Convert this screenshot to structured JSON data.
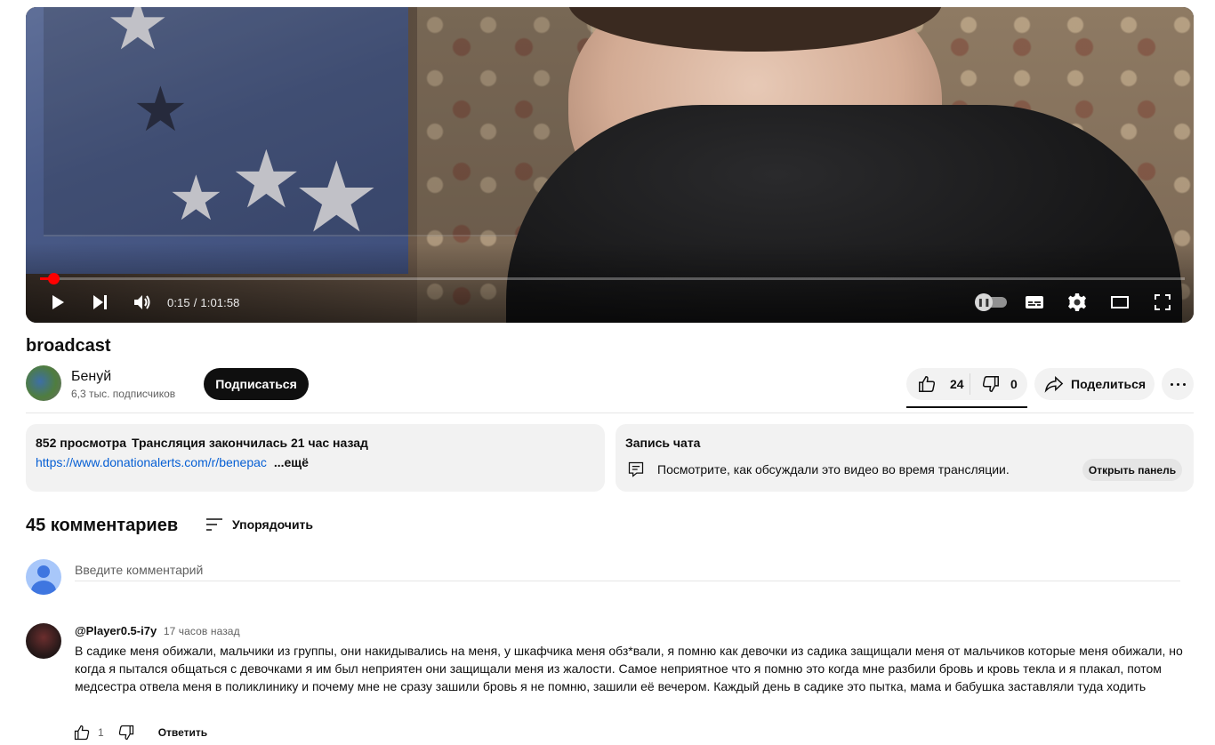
{
  "player": {
    "current_time": "0:15",
    "separator": "/",
    "duration": "1:01:58",
    "progress_fraction": 0.004
  },
  "video": {
    "title": "broadcast",
    "channel_name": "Бенуй",
    "subscribers": "6,3 тыс. подписчиков",
    "subscribe_label": "Подписаться",
    "likes": "24",
    "dislikes": "0",
    "share_label": "Поделиться"
  },
  "description": {
    "views": "852 просмотра",
    "status": "Трансляция закончилась 21 час назад",
    "link": "https://www.donationalerts.com/r/benepac",
    "more_label": "...ещё"
  },
  "chat_replay": {
    "title": "Запись чата",
    "text": "Посмотрите, как обсуждали это видео во время трансляции.",
    "open_label": "Открыть панель"
  },
  "comments": {
    "count_label": "45 комментариев",
    "sort_label": "Упорядочить",
    "input_placeholder": "Введите комментарий",
    "items": [
      {
        "author": "@Player0.5-i7y",
        "time": "17 часов назад",
        "text": "В садике меня обижали, мальчики из группы, они накидывались на меня, у шкафчика меня обз*вали, я помню как девочки из садика защищали меня от мальчиков которые меня обижали, но когда я пытался общаться с девочками я им был неприятен они защищали меня из жалости. Самое неприятное что я помню это когда мне разбили бровь и кровь текла и я плакал, потом медсестра отвела меня в поликлинику и почему мне не сразу зашили бровь я не помню, зашили её вечером. Каждый день в садике это пытка, мама и бабушка заставляли туда ходить",
        "likes": "1",
        "reply_label": "Ответить"
      }
    ]
  },
  "colors": {
    "accent_red": "#ff0000",
    "link_blue": "#065fd4",
    "chip_bg": "#f2f2f2"
  },
  "icons": {
    "player": [
      "play-icon",
      "next-icon",
      "volume-icon",
      "autoplay-toggle-icon",
      "subtitles-icon",
      "settings-icon",
      "theater-icon",
      "fullscreen-icon"
    ],
    "actions": [
      "thumb-up-icon",
      "thumb-down-icon",
      "share-icon",
      "more-icon",
      "chat-icon",
      "sort-icon"
    ]
  }
}
